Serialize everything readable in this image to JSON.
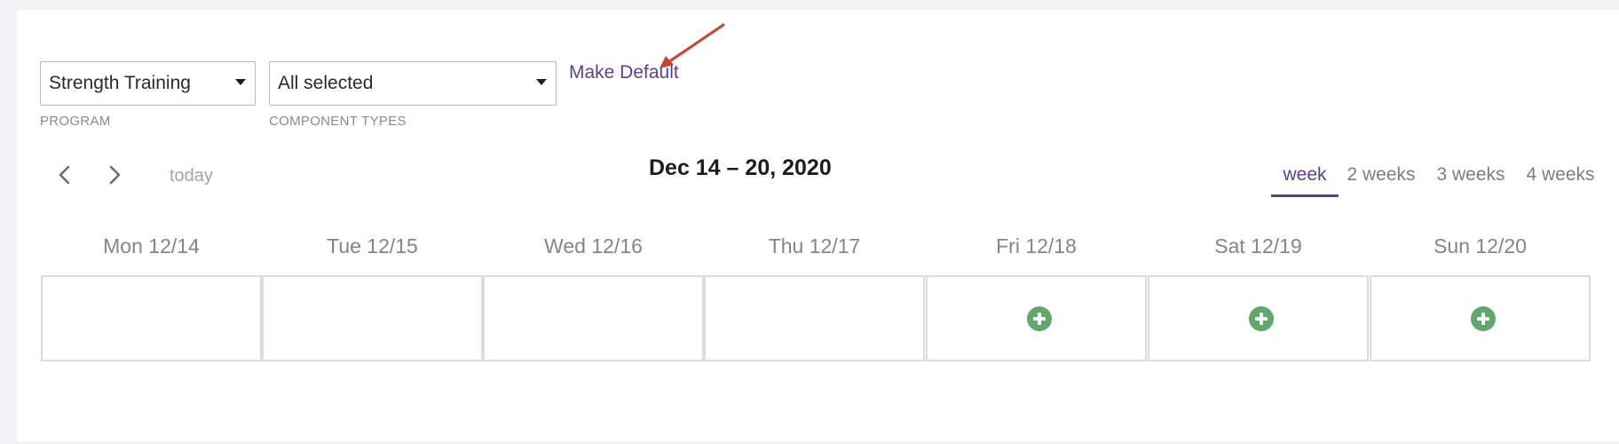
{
  "filters": {
    "program": {
      "value": "Strength Training",
      "label": "PROGRAM"
    },
    "component_types": {
      "value": "All selected",
      "label": "COMPONENT TYPES"
    },
    "make_default_label": "Make Default"
  },
  "navigation": {
    "prev_icon": "chevron-left-icon",
    "next_icon": "chevron-right-icon",
    "today_label": "today",
    "range_title": "Dec 14 – 20, 2020"
  },
  "view_tabs": [
    {
      "label": "week",
      "active": true
    },
    {
      "label": "2 weeks",
      "active": false
    },
    {
      "label": "3 weeks",
      "active": false
    },
    {
      "label": "4 weeks",
      "active": false
    }
  ],
  "days": [
    {
      "label": "Mon 12/14",
      "has_add": false
    },
    {
      "label": "Tue 12/15",
      "has_add": false
    },
    {
      "label": "Wed 12/16",
      "has_add": false
    },
    {
      "label": "Thu 12/17",
      "has_add": false
    },
    {
      "label": "Fri 12/18",
      "has_add": true
    },
    {
      "label": "Sat 12/19",
      "has_add": true
    },
    {
      "label": "Sun 12/20",
      "has_add": true
    }
  ],
  "colors": {
    "accent": "#5b3f97",
    "add_button": "#5fa86a",
    "annotation_arrow": "#c9412f"
  }
}
